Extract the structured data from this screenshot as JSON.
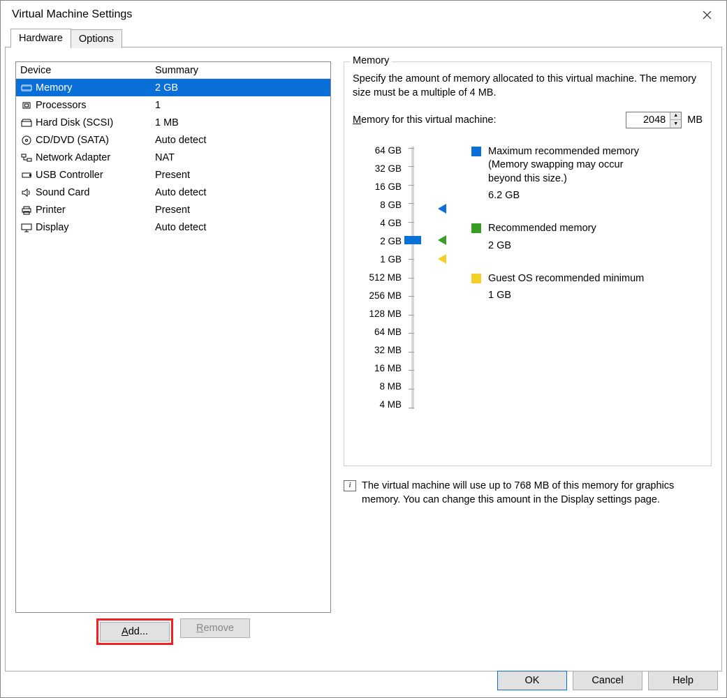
{
  "window": {
    "title": "Virtual Machine Settings"
  },
  "tabs": [
    {
      "label": "Hardware",
      "active": true
    },
    {
      "label": "Options",
      "active": false
    }
  ],
  "deviceTable": {
    "headers": {
      "device": "Device",
      "summary": "Summary"
    },
    "rows": [
      {
        "icon": "memory",
        "device": "Memory",
        "summary": "2 GB",
        "selected": true
      },
      {
        "icon": "cpu",
        "device": "Processors",
        "summary": "1"
      },
      {
        "icon": "disk",
        "device": "Hard Disk (SCSI)",
        "summary": "1 MB"
      },
      {
        "icon": "cd",
        "device": "CD/DVD (SATA)",
        "summary": "Auto detect"
      },
      {
        "icon": "net",
        "device": "Network Adapter",
        "summary": "NAT"
      },
      {
        "icon": "usb",
        "device": "USB Controller",
        "summary": "Present"
      },
      {
        "icon": "sound",
        "device": "Sound Card",
        "summary": "Auto detect"
      },
      {
        "icon": "printer",
        "device": "Printer",
        "summary": "Present"
      },
      {
        "icon": "display",
        "device": "Display",
        "summary": "Auto detect"
      }
    ]
  },
  "leftButtons": {
    "add": "Add...",
    "remove": "Remove"
  },
  "memoryPanel": {
    "title": "Memory",
    "desc": "Specify the amount of memory allocated to this virtual machine. The memory size must be a multiple of 4 MB.",
    "inputLabel": "Memory for this virtual machine:",
    "value": "2048",
    "unit": "MB",
    "sliderTicks": [
      "64 GB",
      "32 GB",
      "16 GB",
      "8 GB",
      "4 GB",
      "2 GB",
      "1 GB",
      "512 MB",
      "256 MB",
      "128 MB",
      "64 MB",
      "32 MB",
      "16 MB",
      "8 MB",
      "4 MB"
    ],
    "markers": {
      "maxRec": {
        "idx": 3.3,
        "color": "blue"
      },
      "rec": {
        "idx": 5,
        "color": "green"
      },
      "min": {
        "idx": 6,
        "color": "yellow"
      }
    },
    "thumbIdx": 5,
    "legend": {
      "max": {
        "color": "#0a6fd8",
        "label": "Maximum recommended memory",
        "sub1": "(Memory swapping may occur beyond this size.)",
        "val": "6.2 GB"
      },
      "rec": {
        "color": "#3a9d23",
        "label": "Recommended memory",
        "val": "2 GB"
      },
      "min": {
        "color": "#f3d027",
        "label": "Guest OS recommended minimum",
        "val": "1 GB"
      }
    },
    "info": "The virtual machine will use up to 768 MB of this memory for graphics memory. You can change this amount in the Display settings page."
  },
  "bottomButtons": {
    "ok": "OK",
    "cancel": "Cancel",
    "help": "Help"
  }
}
